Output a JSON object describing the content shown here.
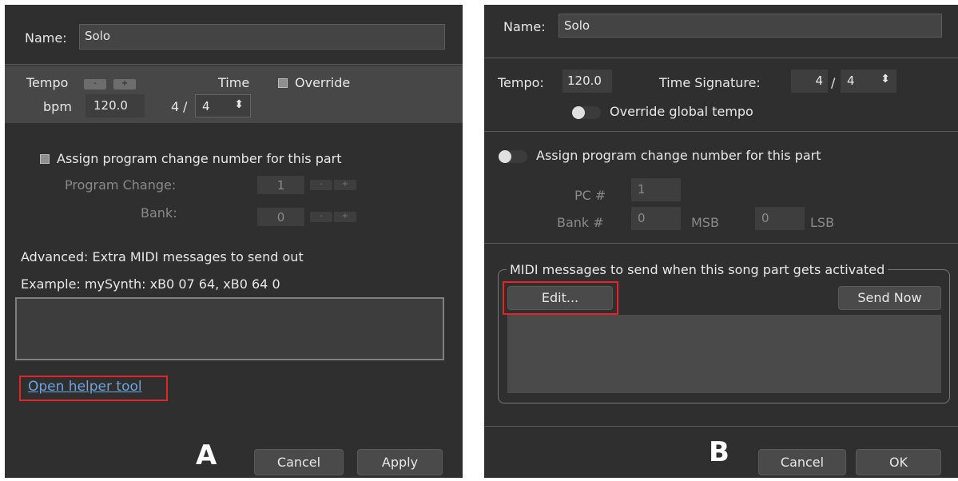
{
  "panelA": {
    "name_label": "Name:",
    "name_value": "Solo",
    "tempo_label": "Tempo",
    "tempo_minus": "-",
    "tempo_plus": "+",
    "time_label": "Time",
    "override_label": "Override",
    "bpm_label": "bpm",
    "tempo_value": "120.0",
    "time_numerator": "4",
    "time_slash": "/",
    "time_denominator": "4",
    "pc_assign_label": "Assign program change number for this part",
    "program_change_label": "Program Change:",
    "program_change_value": "1",
    "bank_label": "Bank:",
    "bank_value": "0",
    "minus": "-",
    "plus": "+",
    "advanced_label": "Advanced: Extra MIDI messages to send out",
    "example_label": "Example: mySynth: xB0 07 64, xB0 64 0",
    "midi_text": "",
    "helper_link": "Open helper tool",
    "marker": "A",
    "cancel": "Cancel",
    "apply": "Apply"
  },
  "panelB": {
    "name_label": "Name:",
    "name_value": "Solo",
    "tempo_label": "Tempo:",
    "tempo_value": "120.0",
    "time_sig_label": "Time Signature:",
    "time_numerator": "4",
    "time_slash": "/",
    "time_denominator": "4",
    "override_label": "Override global tempo",
    "pc_assign_label": "Assign program change number for this part",
    "pc_label": "PC #",
    "pc_value": "1",
    "bank_label": "Bank #",
    "msb_value": "0",
    "msb_label": "MSB",
    "lsb_value": "0",
    "lsb_label": "LSB",
    "group_title": "MIDI messages to send when this song part gets activated",
    "edit_button": "Edit...",
    "send_now_button": "Send Now",
    "midi_text": "",
    "marker": "B",
    "cancel": "Cancel",
    "ok": "OK"
  },
  "colors": {
    "panel_bg": "#2f2f2f",
    "highlight": "#e3242b",
    "link": "#6fa3e0"
  }
}
